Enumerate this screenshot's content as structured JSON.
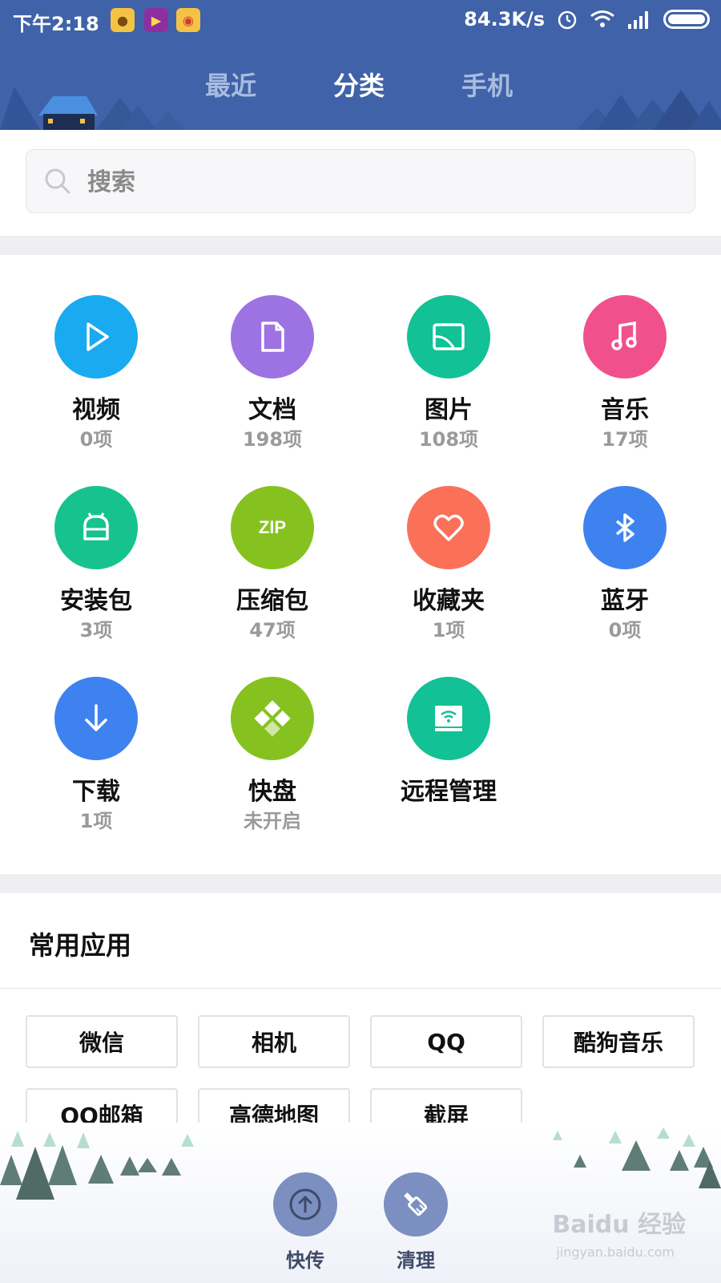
{
  "status_bar": {
    "time": "下午2:18",
    "net_speed": "84.3K/s"
  },
  "tabs": [
    {
      "label": "最近",
      "active": false
    },
    {
      "label": "分类",
      "active": true
    },
    {
      "label": "手机",
      "active": false
    }
  ],
  "search": {
    "placeholder": "搜索"
  },
  "categories": [
    {
      "name": "视频",
      "count": "0项",
      "icon": "play-icon",
      "color": "#19aaf0"
    },
    {
      "name": "文档",
      "count": "198项",
      "icon": "document-icon",
      "color": "#9d73e3"
    },
    {
      "name": "图片",
      "count": "108项",
      "icon": "image-icon",
      "color": "#12c195"
    },
    {
      "name": "音乐",
      "count": "17项",
      "icon": "music-icon",
      "color": "#f0518d"
    },
    {
      "name": "安装包",
      "count": "3项",
      "icon": "android-icon",
      "color": "#16c38f"
    },
    {
      "name": "压缩包",
      "count": "47项",
      "icon": "zip-icon",
      "color": "#86c21f"
    },
    {
      "name": "收藏夹",
      "count": "1项",
      "icon": "heart-icon",
      "color": "#fb7059"
    },
    {
      "name": "蓝牙",
      "count": "0项",
      "icon": "bluetooth-icon",
      "color": "#3e82ef"
    },
    {
      "name": "下载",
      "count": "1项",
      "icon": "download-icon",
      "color": "#3e82ef"
    },
    {
      "name": "快盘",
      "count": "未开启",
      "icon": "kuaipan-icon",
      "color": "#86c21f"
    },
    {
      "name": "远程管理",
      "count": "",
      "icon": "remote-icon",
      "color": "#12c195"
    }
  ],
  "common_apps": {
    "title": "常用应用",
    "items": [
      "微信",
      "相机",
      "QQ",
      "酷狗音乐",
      "QQ邮箱",
      "高德地图",
      "截屏"
    ]
  },
  "bottom_actions": [
    {
      "label": "快传",
      "icon": "upload-icon"
    },
    {
      "label": "清理",
      "icon": "broom-icon"
    }
  ],
  "watermark": {
    "brand": "Baidu 经验",
    "url": "jingyan.baidu.com"
  },
  "colors": {
    "header": "#3f62a8",
    "fab": "#7b8fc0"
  }
}
